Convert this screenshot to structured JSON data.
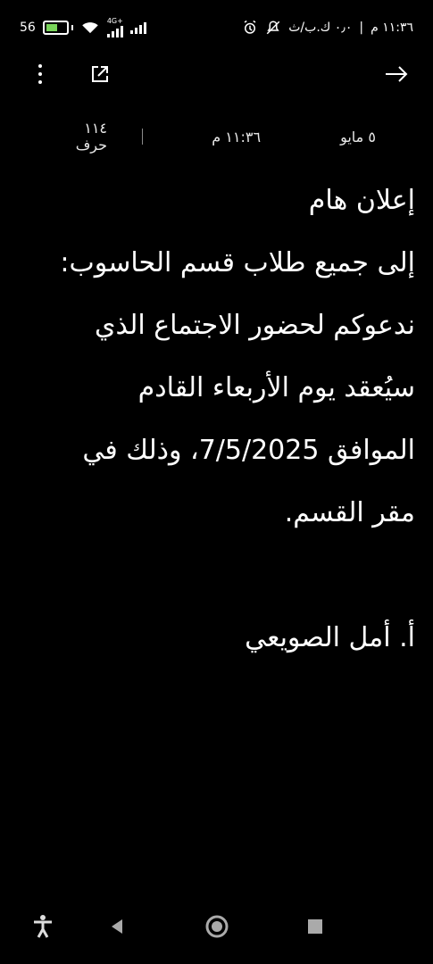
{
  "status_bar": {
    "battery_level": "56",
    "network": "4G+",
    "time": "١١:٣٦ م",
    "data_rate": "٠٫٠ ك.ب/ث",
    "colors": {
      "battery_charging": "#79d45a"
    }
  },
  "toolbar": {
    "more_icon": "more-vert-icon",
    "share_icon": "share-icon",
    "back_icon": "arrow-right-icon"
  },
  "note_info": {
    "date": "٥ مايو",
    "time": "١١:٣٦ م",
    "char_count": "١١٤ حرف"
  },
  "note": {
    "lines": [
      "إعلان هام",
      "إلى جميع طلاب قسم الحاسوب:",
      "ندعوكم لحضور الاجتماع الذي",
      "سيُعقد يوم الأربعاء القادم",
      "الموافق 7/5/2025، وذلك في",
      "مقر القسم.",
      "",
      "أ. أمل الصويعي"
    ]
  },
  "nav": {
    "accessibility_icon": "accessibility-icon",
    "back_icon": "back-triangle-icon",
    "home_icon": "home-circle-icon",
    "recents_icon": "recents-square-icon"
  }
}
